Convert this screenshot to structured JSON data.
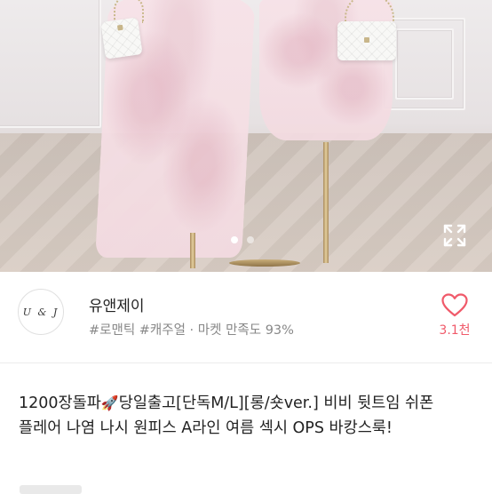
{
  "gallery": {
    "image_label": "product-photo-dresses-on-stands",
    "slide_count": 2,
    "active_slide": 1,
    "expand_icon": "expand-icon"
  },
  "shop": {
    "avatar_text": "U & J",
    "name": "유앤제이",
    "tags": "#로맨틱 #캐주얼 · 마켓 만족도 93%",
    "like_icon": "heart-outline-icon",
    "like_count": "3.1천",
    "accent_color": "#f05a6a"
  },
  "product": {
    "title_part1": "1200장돌파",
    "rocket_emoji": "🚀",
    "title_part2": "당일출고[단독M/L][롱/숏ver.] 비비 뒷트임 쉬폰 플레어 나염 나시 원피스 A라인 여름 섹시 OPS 바캉스룩!"
  }
}
